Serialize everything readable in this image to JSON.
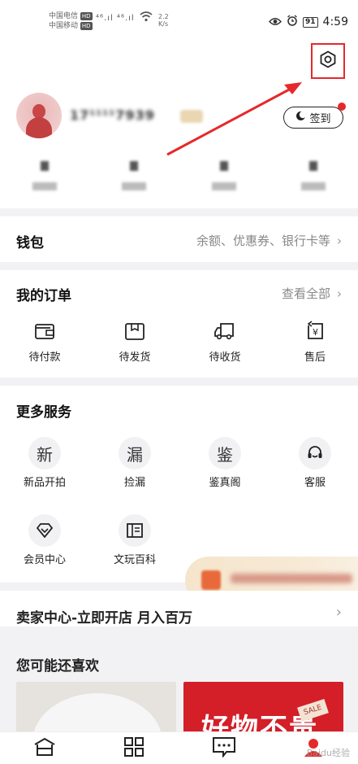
{
  "status_bar": {
    "carrier1": "中国电信",
    "carrier2": "中国移动",
    "hd": "HD",
    "signal": "⁴⁶.ıl ⁴⁶.ıl",
    "speed_value": "2.2",
    "speed_unit": "K/s",
    "battery": "91",
    "time": "4:59"
  },
  "profile": {
    "username": "17¹¹¹¹7939",
    "signin_label": "签到"
  },
  "stats": [
    {
      "label": "—"
    },
    {
      "label": "—"
    },
    {
      "label": "—"
    },
    {
      "label": "—"
    }
  ],
  "wallet": {
    "title": "钱包",
    "subtitle": "余额、优惠券、银行卡等",
    "chevron": "›"
  },
  "orders": {
    "title": "我的订单",
    "view_all": "查看全部",
    "chevron": "›",
    "items": [
      {
        "label": "待付款",
        "icon": "wallet-icon"
      },
      {
        "label": "待发货",
        "icon": "package-icon"
      },
      {
        "label": "待收货",
        "icon": "truck-icon"
      },
      {
        "label": "售后",
        "icon": "refund-icon"
      }
    ]
  },
  "services": {
    "title": "更多服务",
    "items": [
      {
        "label": "新品开拍",
        "glyph": "新",
        "icon": "new-auction-icon"
      },
      {
        "label": "捡漏",
        "glyph": "漏",
        "icon": "bargain-icon"
      },
      {
        "label": "鉴真阁",
        "glyph": "鉴",
        "icon": "appraisal-icon"
      },
      {
        "label": "客服",
        "glyph": "",
        "icon": "headset-icon"
      },
      {
        "label": "会员中心",
        "glyph": "",
        "icon": "diamond-icon"
      },
      {
        "label": "文玩百科",
        "glyph": "",
        "icon": "book-icon"
      }
    ]
  },
  "seller": {
    "title": "卖家中心-立即开店 月入百万",
    "chevron": "›"
  },
  "recommend": {
    "title": "您可能还喜欢",
    "card2_text": "好物不贵",
    "card2_tag": "SALE"
  },
  "tabbar": [
    {
      "icon": "home-icon"
    },
    {
      "icon": "category-icon"
    },
    {
      "icon": "message-icon"
    },
    {
      "icon": "profile-icon"
    }
  ],
  "watermark": "Baidu经验",
  "colors": {
    "accent": "#e5292b",
    "background": "#f2f2f4"
  }
}
